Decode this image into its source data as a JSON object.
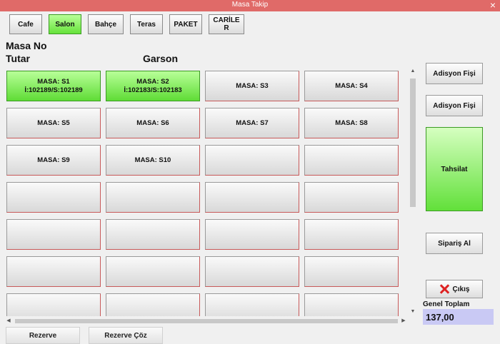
{
  "window": {
    "title": "Masa Takip",
    "close_glyph": "×"
  },
  "tabs": [
    {
      "label": "Cafe",
      "active": false
    },
    {
      "label": "Salon",
      "active": true
    },
    {
      "label": "Bahçe",
      "active": false
    },
    {
      "label": "Teras",
      "active": false
    },
    {
      "label": "PAKET",
      "active": false
    },
    {
      "label": "CARİLE R",
      "active": false
    }
  ],
  "labels": {
    "masa_no": "Masa No",
    "tutar": "Tutar",
    "garson": "Garson"
  },
  "tables": [
    {
      "line1": "MASA: S1",
      "line2": "İ:102189/S:102189",
      "occupied": true
    },
    {
      "line1": "MASA: S2",
      "line2": "İ:102183/S:102183",
      "occupied": true
    },
    {
      "line1": "MASA: S3",
      "line2": "",
      "occupied": false
    },
    {
      "line1": "MASA: S4",
      "line2": "",
      "occupied": false
    },
    {
      "line1": "MASA: S5",
      "line2": "",
      "occupied": false
    },
    {
      "line1": "MASA: S6",
      "line2": "",
      "occupied": false
    },
    {
      "line1": "MASA: S7",
      "line2": "",
      "occupied": false
    },
    {
      "line1": "MASA: S8",
      "line2": "",
      "occupied": false
    },
    {
      "line1": "MASA: S9",
      "line2": "",
      "occupied": false
    },
    {
      "line1": "MASA: S10",
      "line2": "",
      "occupied": false
    },
    {
      "line1": "",
      "line2": "",
      "occupied": false
    },
    {
      "line1": "",
      "line2": "",
      "occupied": false
    },
    {
      "line1": "",
      "line2": "",
      "occupied": false
    },
    {
      "line1": "",
      "line2": "",
      "occupied": false
    },
    {
      "line1": "",
      "line2": "",
      "occupied": false
    },
    {
      "line1": "",
      "line2": "",
      "occupied": false
    },
    {
      "line1": "",
      "line2": "",
      "occupied": false
    },
    {
      "line1": "",
      "line2": "",
      "occupied": false
    },
    {
      "line1": "",
      "line2": "",
      "occupied": false
    },
    {
      "line1": "",
      "line2": "",
      "occupied": false
    },
    {
      "line1": "",
      "line2": "",
      "occupied": false
    },
    {
      "line1": "",
      "line2": "",
      "occupied": false
    },
    {
      "line1": "",
      "line2": "",
      "occupied": false
    },
    {
      "line1": "",
      "line2": "",
      "occupied": false
    },
    {
      "line1": "",
      "line2": "",
      "occupied": false
    },
    {
      "line1": "",
      "line2": "",
      "occupied": false
    },
    {
      "line1": "",
      "line2": "",
      "occupied": false
    },
    {
      "line1": "",
      "line2": "",
      "occupied": false
    }
  ],
  "side": {
    "adisyon_fisi_1": "Adisyon Fişi",
    "adisyon_fisi_2": "Adisyon Fişi",
    "tahsilat": "Tahsilat",
    "siparis_al": "Sipariş Al",
    "cikis": "Çıkış"
  },
  "total": {
    "label": "Genel Toplam",
    "value": "137,00"
  },
  "bottom": {
    "rezerve": "Rezerve",
    "rezerve_coz": "Rezerve Çöz"
  },
  "colors": {
    "occupied": "#66e23a",
    "titlebar": "#e06a68",
    "total_bg": "#c9c9f4"
  },
  "icons": {
    "close": "close-icon",
    "exit": "exit-x-icon"
  }
}
